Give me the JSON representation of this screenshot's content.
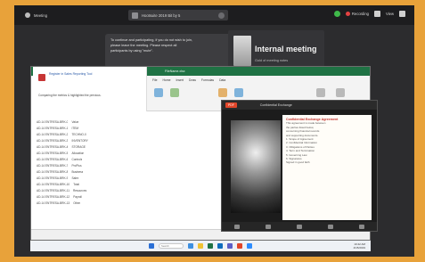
{
  "topbar": {
    "left_label": "Meeting",
    "window_title": "Hootsuite 2019 Bit by 5",
    "recording_label": "Recording",
    "view_label": "View"
  },
  "notification": {
    "line1": "To continue and participating, if you do not wish to join,",
    "line2": "please leave the meeting. Please respect all",
    "line3": "participants by using \"mute\"."
  },
  "meeting": {
    "title": "Internal meeting",
    "subtitle": "Gold of meeting notes"
  },
  "outlook": {
    "link_text": "Register in Sales Reporting Tool",
    "sub_text": "Comparing the metrics & highlighted the previous."
  },
  "excel": {
    "title": "FileName.xlsx",
    "ribbon_tabs": [
      "File",
      "Home",
      "Insert",
      "Draw",
      "Formulas",
      "Data"
    ],
    "rows": [
      [
        "AD-14 ENTRESA-BRK-0",
        "Value"
      ],
      [
        "AD-14 ENTRESA-BRK-1",
        "ITEM"
      ],
      [
        "AD-14 ENTRESA-BRK-2",
        "TECHNO-0"
      ],
      [
        "AD-14 ENTRESA-BRK-3",
        "INVENTORY"
      ],
      [
        "AD-14 ENTRESA-BRK-4",
        "STORAGE"
      ],
      [
        "AD-14 ENTRESA-BRK-5",
        "Allocation"
      ],
      [
        "AD-14 ENTRESA-BRK-6",
        "Controls"
      ],
      [
        "AD-14 ENTRESA-BRK-7",
        "ProPlus"
      ],
      [
        "AD-14 ENTRESA-BRK-8",
        "Business"
      ],
      [
        "AD-14 ENTRESA-BRK-9",
        "Sales"
      ],
      [
        "AD-14 ENTRESA-BRK-10",
        "Total"
      ],
      [
        "AD-14 ENTRESA-BRK-11",
        "Resources"
      ],
      [
        "AD-14 ENTRESA-BRK-12",
        "Payroll"
      ],
      [
        "AD-14 ENTRESA-BRK-13",
        "Other"
      ]
    ]
  },
  "viewer": {
    "badge": "PDF",
    "title": "Confidential Exchange",
    "heading": "Confidential Exchange Agreement",
    "lines": [
      "This agreement is made between",
      "the parties listed below,",
      "concerning financial records",
      "and supporting documents.",
      "1. Scope of Agreement",
      "2. Confidential Information",
      "3. Obligations of Parties",
      "4. Term and Termination",
      "5. Governing Law",
      "6. Signatures",
      "Signed in good faith"
    ]
  },
  "taskbar": {
    "search_placeholder": "Search",
    "time": "10:42 AM",
    "date": "4/15/2019"
  },
  "colors": {
    "frame": "#e8a23a",
    "excel_green": "#1f7244",
    "pdf_red": "#e1462a"
  }
}
